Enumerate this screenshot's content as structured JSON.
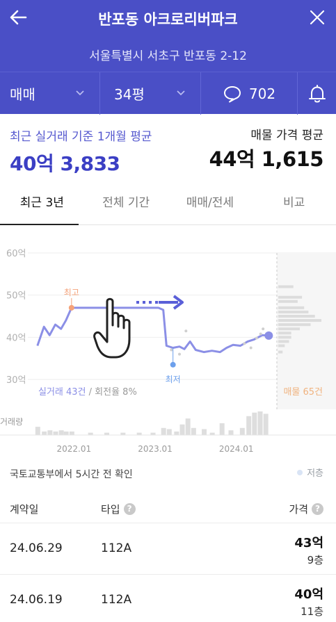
{
  "header": {
    "title": "반포동 아크로리버파크",
    "address": "서울특별시 서초구 반포동 2-12"
  },
  "selectors": {
    "trade_type": "매매",
    "size": "34평",
    "comment_count": "702"
  },
  "averages": {
    "recent_label": "최근 실거래 기준 1개월 평균",
    "recent_value": "40억 3,833",
    "listing_label": "매물 가격 평균",
    "listing_value": "44억 1,615"
  },
  "tabs": [
    {
      "label": "최근 3년",
      "active": true
    },
    {
      "label": "전체 기간",
      "active": false
    },
    {
      "label": "매매/전세",
      "active": false
    },
    {
      "label": "비교",
      "active": false
    }
  ],
  "chart_data": {
    "type": "line",
    "y_ticks": [
      "60억",
      "50억",
      "40억",
      "30억"
    ],
    "ylim": [
      30,
      60
    ],
    "x_ticks": [
      "2022.01",
      "2023.01",
      "2024.01"
    ],
    "series": [
      {
        "name": "실거래",
        "color": "#8b8fe6",
        "points": [
          [
            2021.55,
            38
          ],
          [
            2021.63,
            42.5
          ],
          [
            2021.7,
            40.5
          ],
          [
            2021.77,
            43
          ],
          [
            2021.84,
            42
          ],
          [
            2021.9,
            44
          ],
          [
            2021.97,
            47
          ],
          [
            2022.3,
            47
          ],
          [
            2022.7,
            47
          ],
          [
            2023.04,
            47
          ],
          [
            2023.1,
            46.5
          ],
          [
            2023.14,
            38
          ],
          [
            2023.22,
            37.5
          ],
          [
            2023.3,
            37.8
          ],
          [
            2023.36,
            37.2
          ],
          [
            2023.43,
            39
          ],
          [
            2023.5,
            37
          ],
          [
            2023.6,
            36.5
          ],
          [
            2023.7,
            36.8
          ],
          [
            2023.8,
            36.5
          ],
          [
            2023.88,
            37.5
          ],
          [
            2023.96,
            38.2
          ],
          [
            2024.05,
            38
          ],
          [
            2024.14,
            39
          ],
          [
            2024.22,
            39.5
          ],
          [
            2024.32,
            40.5
          ],
          [
            2024.4,
            40.4
          ]
        ]
      }
    ],
    "markers": [
      {
        "label": "최고",
        "x": 2021.97,
        "y": 47,
        "color": "#f4a27a"
      },
      {
        "label": "최저",
        "x": 2023.22,
        "y": 33.5,
        "color": "#6da0ec"
      }
    ],
    "scatter": [
      [
        2023.2,
        37
      ],
      [
        2023.3,
        36
      ],
      [
        2023.38,
        41.5
      ],
      [
        2024.1,
        38.5
      ],
      [
        2024.18,
        37.5
      ],
      [
        2024.25,
        39.8
      ],
      [
        2024.3,
        40.8
      ],
      [
        2024.33,
        42
      ]
    ],
    "listing_bands": [
      [
        52,
        0.35
      ],
      [
        49.5,
        0.55
      ],
      [
        48.5,
        0.45
      ],
      [
        47,
        0.6
      ],
      [
        46,
        0.7
      ],
      [
        45,
        0.85
      ],
      [
        44,
        1.0
      ],
      [
        43,
        0.75
      ],
      [
        42,
        0.5
      ],
      [
        41,
        0.3
      ],
      [
        40,
        0.3
      ],
      [
        39,
        0.25
      ],
      [
        38,
        0.15
      ],
      [
        36.5,
        0.1
      ]
    ],
    "volume_bars": [
      [
        2021.55,
        0.35
      ],
      [
        2021.63,
        0.15
      ],
      [
        2021.7,
        0.2
      ],
      [
        2021.77,
        0.15
      ],
      [
        2021.84,
        0.2
      ],
      [
        2021.9,
        0.15
      ],
      [
        2021.97,
        0.15
      ],
      [
        2022.2,
        0.1
      ],
      [
        2022.4,
        0.1
      ],
      [
        2022.6,
        0.1
      ],
      [
        2022.8,
        0.1
      ],
      [
        2022.97,
        0.1
      ],
      [
        2023.1,
        0.3
      ],
      [
        2023.17,
        0.25
      ],
      [
        2023.26,
        0.15
      ],
      [
        2023.33,
        0.45
      ],
      [
        2023.4,
        0.7
      ],
      [
        2023.47,
        0.3
      ],
      [
        2023.6,
        0.25
      ],
      [
        2023.7,
        0.1
      ],
      [
        2023.82,
        0.5
      ],
      [
        2023.93,
        0.2
      ],
      [
        2024.07,
        0.3
      ],
      [
        2024.15,
        0.8
      ],
      [
        2024.22,
        0.95
      ],
      [
        2024.29,
        1.0
      ],
      [
        2024.36,
        0.9
      ]
    ],
    "annotations": {
      "trade_count": "실거래 43건",
      "turnover": " / 회전율 8%",
      "listing_count": "매물 65건",
      "volume_label": "거래량"
    }
  },
  "table": {
    "source": "국토교통부에서 5시간 전 확인",
    "legend_low": "저층",
    "headers": {
      "date": "계약일",
      "type": "타입",
      "price": "가격"
    },
    "rows": [
      {
        "date": "24.06.29",
        "type": "112A",
        "price": "43억",
        "floor": "9층"
      },
      {
        "date": "24.06.19",
        "type": "112A",
        "price": "40억",
        "floor": "11층"
      }
    ]
  }
}
